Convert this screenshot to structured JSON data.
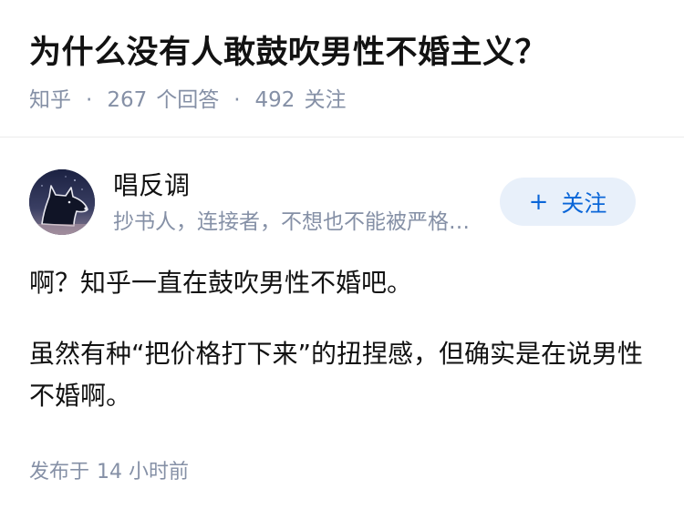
{
  "question": {
    "title": "为什么没有人敢鼓吹男性不婚主义？",
    "source": "知乎",
    "separator": "·",
    "answers_count": "267",
    "answers_label": "个回答",
    "followers_count": "492",
    "followers_label": "关注"
  },
  "author": {
    "name": "唱反调",
    "bio": "抄书人，连接者，不想也不能被严格定义的人",
    "avatar_icon": "dog-avatar-icon",
    "follow_label": "关注",
    "follow_icon": "plus-icon"
  },
  "answer": {
    "paragraphs": [
      "啊？知乎一直在鼓吹男性不婚吧。",
      "虽然有种“把价格打下来”的扭捏感，但确实是在说男性不婚啊。"
    ]
  },
  "footer": {
    "published_label": "发布于",
    "published_time": "14 小时前"
  },
  "colors": {
    "text": "#121212",
    "meta": "#8590a6",
    "accent": "#0a66d8",
    "follow_bg": "#e8f0fa"
  }
}
